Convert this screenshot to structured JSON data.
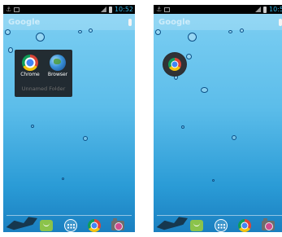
{
  "status_bar": {
    "left_icons": [
      "usb-icon",
      "picture-icon"
    ],
    "right_icons": [
      "signal-icon",
      "battery-icon"
    ],
    "time_left": "10:52",
    "time_right": "10:5"
  },
  "search": {
    "label": "Google",
    "mic_icon": "mic-icon"
  },
  "folder": {
    "name": "Unnamed Folder",
    "apps": [
      {
        "label": "Chrome",
        "icon": "chrome-icon"
      },
      {
        "label": "Browser",
        "icon": "browser-globe-icon"
      }
    ],
    "state_right": "collapsed"
  },
  "dock": {
    "icons": [
      "branch-icon",
      "messaging-icon",
      "all-apps-icon",
      "chrome-icon",
      "camera-icon"
    ]
  },
  "colors": {
    "status_bar": "#000000",
    "clock": "#33b5e5",
    "wallpaper_top": "#7fd0f3",
    "wallpaper_bottom": "#1a7fc0",
    "folder_bg": "#1c1e22"
  }
}
